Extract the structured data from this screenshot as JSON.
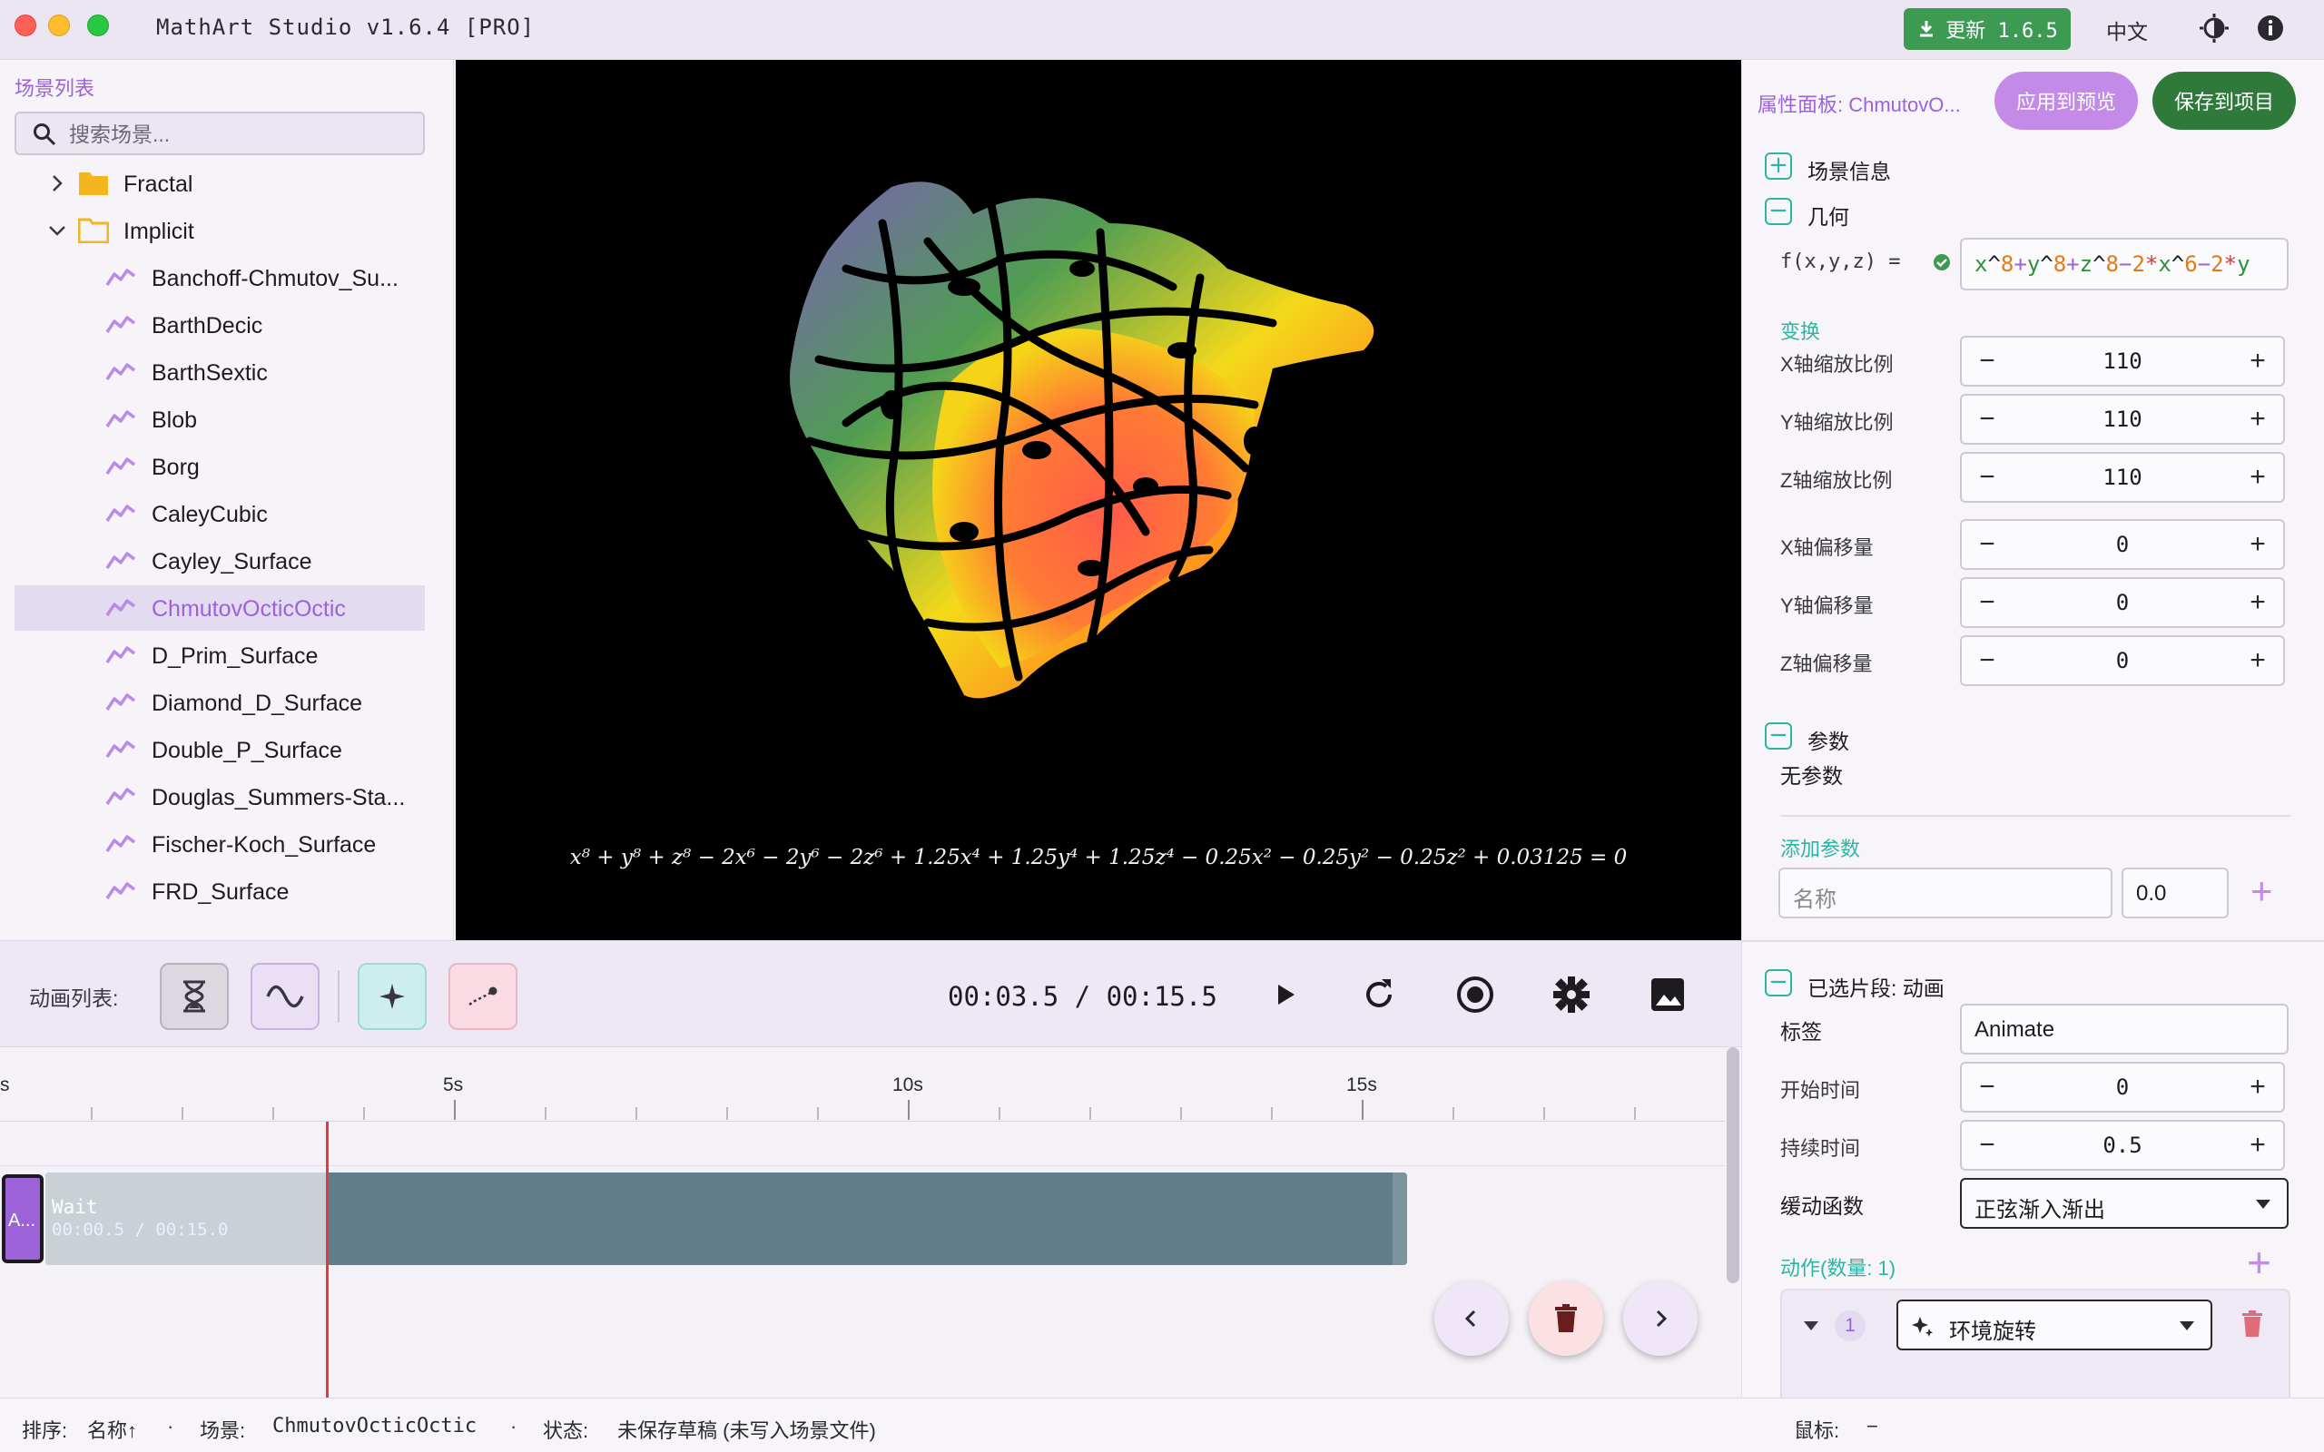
{
  "window": {
    "title": "MathArt Studio v1.6.4 [PRO]",
    "update_label": "更新 1.6.5",
    "language": "中文"
  },
  "scene_list": {
    "title": "场景列表",
    "search_placeholder": "搜索场景...",
    "folders": [
      {
        "name": "Fractal",
        "expanded": false
      },
      {
        "name": "Implicit",
        "expanded": true
      }
    ],
    "items": [
      "Banchoff-Chmutov_Su...",
      "BarthDecic",
      "BarthSextic",
      "Blob",
      "Borg",
      "CaleyCubic",
      "Cayley_Surface",
      "ChmutovOcticOctic",
      "D_Prim_Surface",
      "Diamond_D_Surface",
      "Double_P_Surface",
      "Douglas_Summers-Sta...",
      "Fischer-Koch_Surface",
      "FRD_Surface"
    ],
    "selected": "ChmutovOcticOctic"
  },
  "canvas": {
    "equation": "x⁸ + y⁸ + z⁸ − 2x⁶ − 2y⁶ − 2z⁶ + 1.25x⁴ + 1.25y⁴ + 1.25z⁴ − 0.25x² − 0.25y² − 0.25z² + 0.03125 = 0"
  },
  "properties": {
    "title": "属性面板: ChmutovO...",
    "apply_label": "应用到预览",
    "save_label": "保存到项目",
    "sections": {
      "scene_info": "场景信息",
      "geometry": "几何",
      "params": "参数",
      "selected_clip": "已选片段: 动画"
    },
    "formula_label": "f(x,y,z) =",
    "formula_parts": [
      "x",
      "^",
      "8",
      "+",
      "y",
      "^",
      "8",
      "+",
      "z",
      "^",
      "8",
      "−",
      "2",
      "*",
      "x",
      "^",
      "6",
      "−",
      "2",
      "*",
      "y"
    ],
    "transform_title": "变换",
    "transforms": [
      {
        "label": "X轴缩放比例",
        "value": "110"
      },
      {
        "label": "Y轴缩放比例",
        "value": "110"
      },
      {
        "label": "Z轴缩放比例",
        "value": "110"
      },
      {
        "label": "X轴偏移量",
        "value": "0"
      },
      {
        "label": "Y轴偏移量",
        "value": "0"
      },
      {
        "label": "Z轴偏移量",
        "value": "0"
      }
    ],
    "no_params": "无参数",
    "add_param_title": "添加参数",
    "param_name_placeholder": "名称",
    "param_value": "0.0",
    "clip": {
      "tag_label": "标签",
      "tag_value": "Animate",
      "start_label": "开始时间",
      "start_value": "0",
      "duration_label": "持续时间",
      "duration_value": "0.5",
      "easing_label": "缓动函数",
      "easing_value": "正弦渐入渐出",
      "actions_title": "动作(数量: 1)",
      "action_index": "1",
      "action_name": "环境旋转"
    }
  },
  "toolbar": {
    "anim_list_label": "动画列表:",
    "time_display": "00:03.5 / 00:15.5"
  },
  "timeline": {
    "tick_labels": [
      "s",
      "5s",
      "10s",
      "15s"
    ],
    "clip_a_label": "A...",
    "wait_clip_name": "Wait",
    "wait_clip_time": "00:00.5 / 00:15.0",
    "progress": 0.2
  },
  "statusbar": {
    "sort_label": "排序:",
    "sort_value": "名称↑",
    "scene_label": "场景:",
    "scene_value": "ChmutovOcticOctic",
    "state_label": "状态:",
    "state_value": "未保存草稿 (未写入场景文件)",
    "mouse_label": "鼠标:",
    "mouse_value": "−"
  },
  "colors": {
    "accent": "#9c63d9",
    "teal": "#2bb5a3",
    "update_green": "#3c9a52",
    "save_green": "#2f7a3a",
    "playhead": "#e33b3b"
  }
}
